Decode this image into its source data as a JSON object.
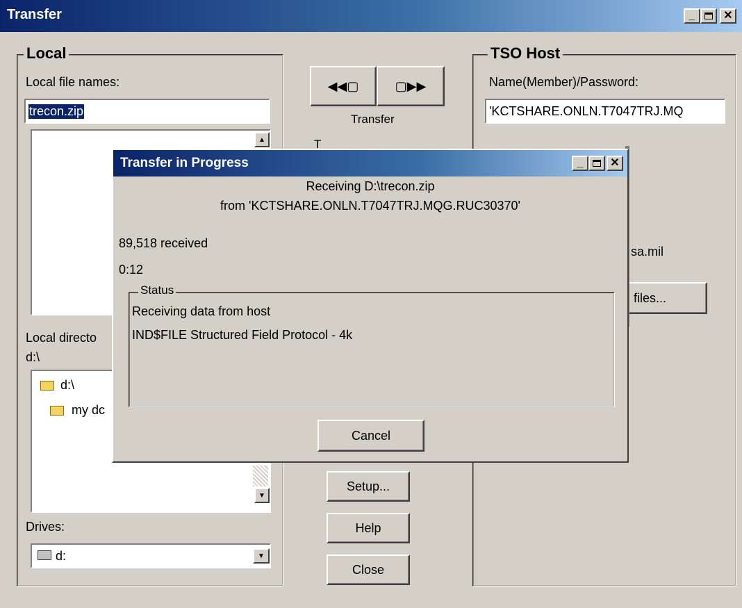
{
  "window": {
    "title": "Transfer"
  },
  "local": {
    "legend": "Local",
    "file_names_label": "Local file names:",
    "file_name_value": "trecon.zip",
    "directory_label": "Local directo",
    "directory_value": "d:\\",
    "tree": [
      {
        "label": "d:\\"
      },
      {
        "label": "my dc"
      }
    ],
    "drives_label": "Drives:",
    "drive_value": "d:"
  },
  "middle": {
    "transfer_label": "Transfer",
    "setup_label": "Setup...",
    "help_label": "Help",
    "close_label": "Close"
  },
  "host": {
    "legend": "TSO Host",
    "name_label": "Name(Member)/Password:",
    "name_value": "'KCTSHARE.ONLN.T7047TRJ.MQ",
    "partial_text": "sa.mil",
    "files_button_label": "files..."
  },
  "progress_dialog": {
    "title": "Transfer in Progress",
    "receiving_line": "Receiving D:\\trecon.zip",
    "from_line": "from 'KCTSHARE.ONLN.T7047TRJ.MQG.RUC30370'",
    "received": "89,518 received",
    "elapsed": "0:12",
    "status_legend": "Status",
    "status_lines": [
      "Receiving data from host",
      "IND$FILE Structured Field Protocol - 4k"
    ],
    "cancel_label": "Cancel"
  },
  "icons": {
    "receive": "receive-file-icon",
    "send": "send-file-icon",
    "drive": "drive-icon",
    "folder": "folder-icon"
  },
  "colors": {
    "titlebar_start": "#0a246a",
    "titlebar_end": "#a6caf0",
    "selection": "#0a246a",
    "face": "#d4d0c8"
  }
}
